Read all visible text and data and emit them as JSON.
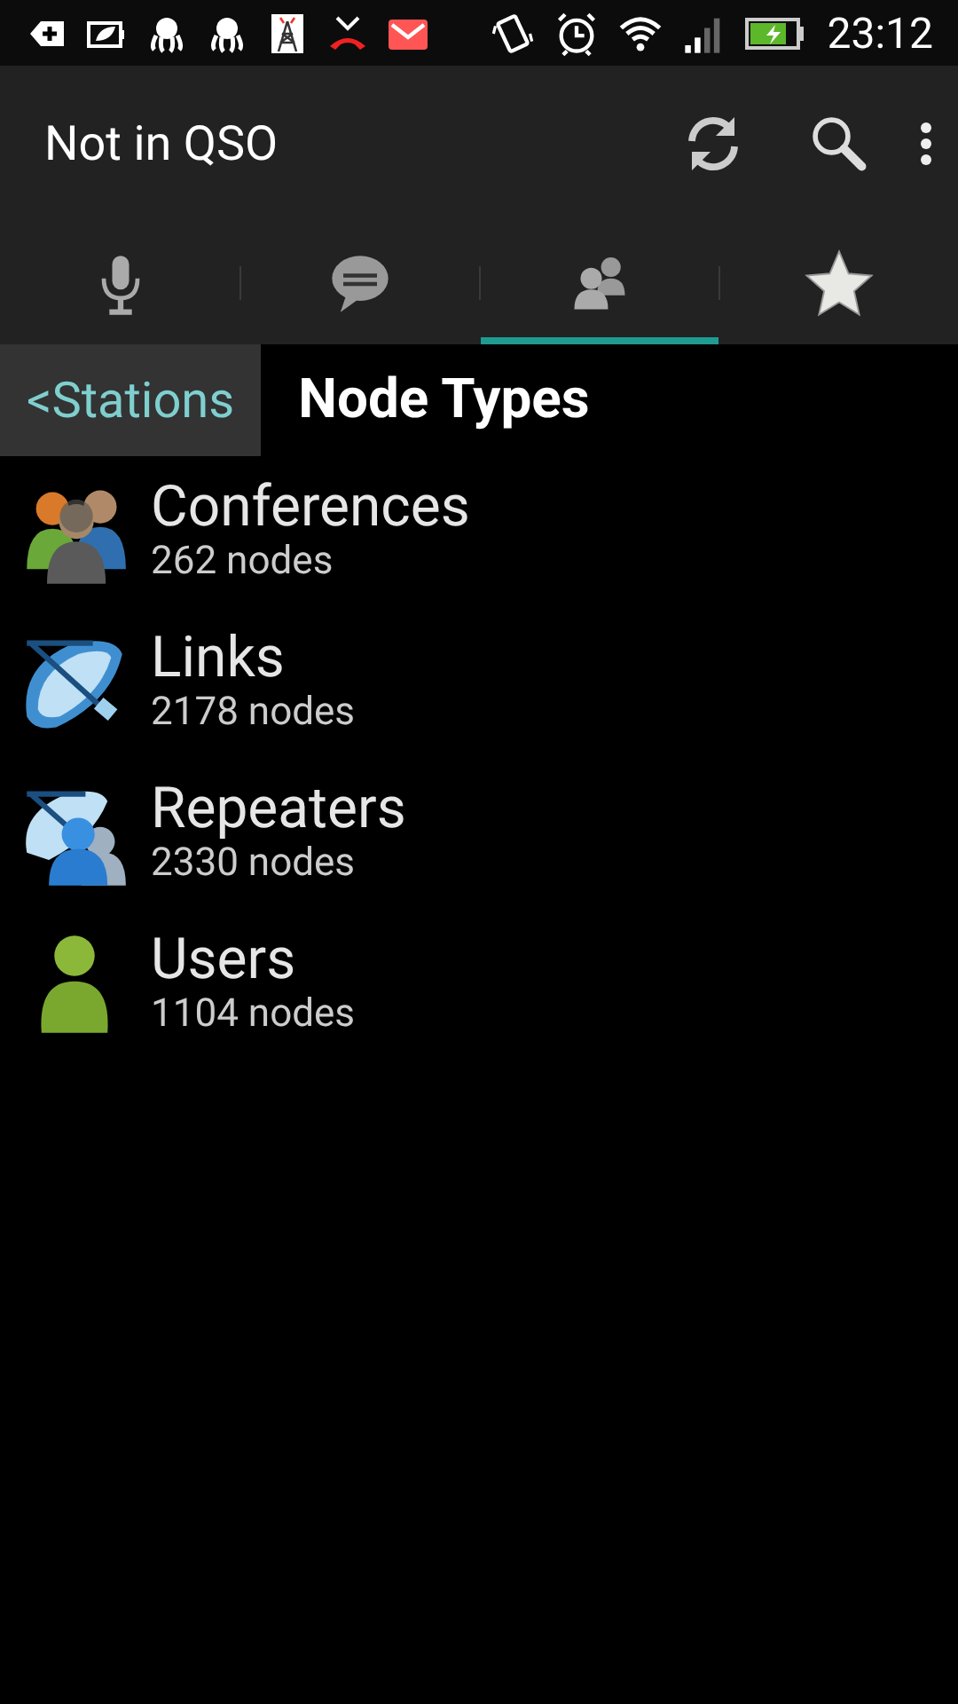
{
  "status_bar": {
    "time": "23:12"
  },
  "action_bar": {
    "title": "Not in QSO"
  },
  "tabs": [
    {
      "kind": "mic",
      "selected": false
    },
    {
      "kind": "chat",
      "selected": false
    },
    {
      "kind": "people",
      "selected": true
    },
    {
      "kind": "star",
      "selected": false
    }
  ],
  "breadcrumb": {
    "back": "<Stations",
    "title": "Node Types"
  },
  "node_types": [
    {
      "kind": "conference",
      "name": "Conferences",
      "count": "262 nodes"
    },
    {
      "kind": "link",
      "name": "Links",
      "count": "2178 nodes"
    },
    {
      "kind": "repeater",
      "name": "Repeaters",
      "count": "2330 nodes"
    },
    {
      "kind": "user",
      "name": "Users",
      "count": "1104 nodes"
    }
  ]
}
